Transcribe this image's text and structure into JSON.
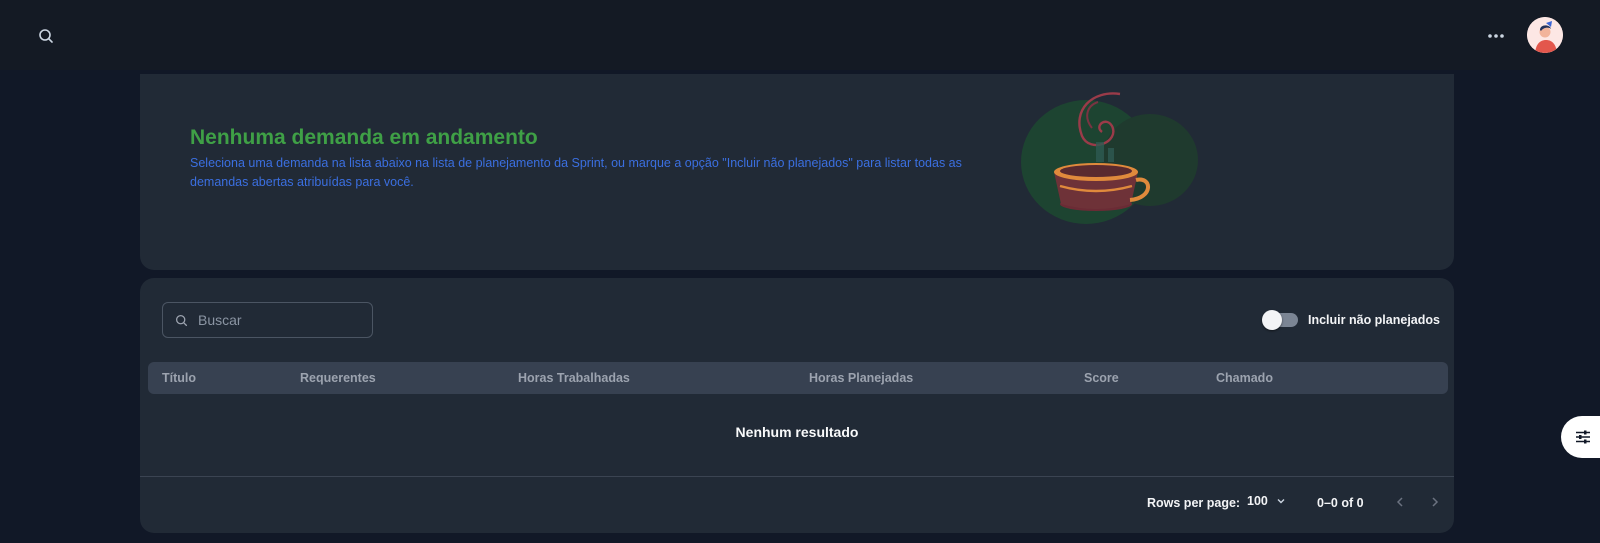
{
  "hero": {
    "title": "Nenhuma demanda em andamento",
    "description": "Seleciona uma demanda na lista abaixo na lista de planejamento da Sprint, ou marque a opção \"Incluir não planejados\" para listar todas as demandas abertas atribuídas para você."
  },
  "search": {
    "placeholder": "Buscar"
  },
  "toggle": {
    "label": "Incluir não planejados",
    "on": false
  },
  "table": {
    "columns": [
      "Título",
      "Requerentes",
      "Horas Trabalhadas",
      "Horas Planejadas",
      "Score",
      "Chamado"
    ],
    "empty_text": "Nenhum resultado"
  },
  "pagination": {
    "rows_per_page_label": "Rows per page:",
    "rows_per_page_value": "100",
    "range": "0–0 of 0"
  },
  "colors": {
    "background": "#111827",
    "card": "#212a36",
    "title_green": "#3fa046",
    "desc_blue": "#3b6fe0"
  },
  "icons": [
    "search-icon",
    "more-horizontal-icon",
    "avatar",
    "coffee-cup-illustration",
    "chevron-down-icon",
    "chevron-left-icon",
    "chevron-right-icon",
    "sliders-icon"
  ]
}
